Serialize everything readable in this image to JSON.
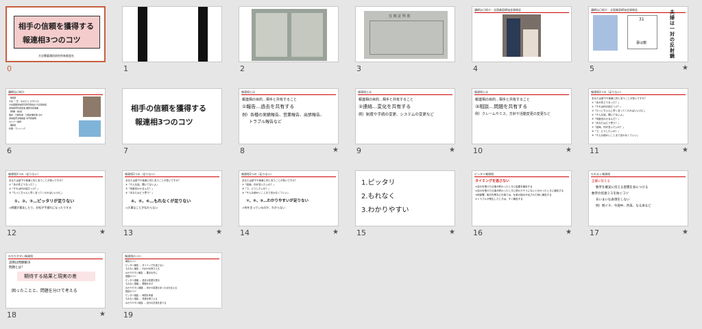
{
  "slides": [
    {
      "num": "0",
      "star": false,
      "title_lines": [
        "相手の信頼を獲得する",
        "報連相3つのコツ"
      ],
      "company": "大谷需要通信研究所有限会社"
    },
    {
      "num": "1",
      "star": false
    },
    {
      "num": "2",
      "star": false
    },
    {
      "num": "3",
      "star": false,
      "doc_title": "在 籍 証 明 書"
    },
    {
      "num": "4",
      "star": false,
      "header": "講師自己紹介：全国美容師協会資格会"
    },
    {
      "num": "5",
      "star": true,
      "header": "講師自己紹介：全国美容師協会資格会",
      "chip_num": "31",
      "chip_text": "妻は鏡",
      "vertical": "夫婦は一対の反射鏡"
    },
    {
      "num": "6",
      "star": false,
      "header": "講師自己紹介",
      "lines": [
        "【経歴】",
        "大谷 一 宏 （おおたに かずひろ）",
        "大谷需要通信研究所有限会社 代表取締役",
        "通信販売利用促進 業務支援事業",
        "【著書・講演】",
        "雑誌・日経新聞・日経産業新聞 ほか",
        "通信販売法規講座 専門家顧問",
        "セミナー講師",
        "【趣味】",
        "料理・ランニング"
      ]
    },
    {
      "num": "7",
      "star": false,
      "title_lines": [
        "相手の信頼を獲得する",
        "報連相3つのコツ"
      ]
    },
    {
      "num": "8",
      "star": true,
      "header": "報連相とは",
      "intro": "報連相の目的…相手と共有すること",
      "line1": "①報告…過去を共有する",
      "line2": "例）各種の実績報告、営業報告、出張報告、",
      "line3": "トラブル報告など"
    },
    {
      "num": "9",
      "star": true,
      "header": "報連相とは",
      "intro": "報連相の目的…相手と共有すること",
      "line1": "②連絡…変化を共有する",
      "line2": "例）制度や手続の変更、システムの変更など"
    },
    {
      "num": "10",
      "star": true,
      "header": "報連相とは",
      "intro": "報連相の目的…相手と共有すること",
      "line1": "③相談…問題を共有する",
      "line2": "例）クレームやミス、方針や活動変更の変更など"
    },
    {
      "num": "11",
      "star": true,
      "header": "報連相3つの（足りない）",
      "lines": [
        "あなたは部下や後輩に何と言うことが多いですか？",
        "①「あの件どうなった？」",
        "②「それは何の話だっけ？」",
        "③「もっとちゃんと早く言ってくれればいいのに」",
        "④「そんな話、聞いてないよ」",
        "⑤「何度言わせるんだ？」",
        "⑥「あなたはどう思う？」",
        "⑦「結局、何が言いたいの？」",
        "⑧「で、どうしたいの？」",
        "⑨「そんな細かいことまで言わなくていい」"
      ]
    },
    {
      "num": "12",
      "star": true,
      "header": "報連相3つの（足りない）",
      "lines": [
        "あなたは部下や後輩に何と言うことが多いですか？",
        "①「あの件どうなった？」",
        "②「それは何の話だっけ？」",
        "③「もっとちゃんと早く言ってくれればいいのに」"
      ],
      "big": "①、②、③…ピッタリが足りない",
      "conclusion": "⇒問題が悪化したり、対処が手遅れになったりする"
    },
    {
      "num": "13",
      "star": true,
      "header": "報連相3つの（足りない）",
      "lines": [
        "あなたは部下や後輩に何と言うことが多いですか？",
        "④「そんな話、聞いてないよ」",
        "⑤「何度言わせるんだ？」",
        "⑥「あなたはどう思う？」"
      ],
      "big": "④、⑤、⑥…もれなくが足りない",
      "conclusion": "⇒大事なことが伝わらない"
    },
    {
      "num": "14",
      "star": true,
      "header": "報連相3つの（足りない）",
      "lines": [
        "あなたは部下や後輩に何と言うことが多いですか？",
        "⑦「結局、何が言いたいの？」",
        "⑧「で、どうしたいの？」",
        "⑨「そんな細かいことまで言わなくていい」"
      ],
      "big": "⑦、⑧、⑨…わかりやすいが足りない",
      "conclusion": "⇒何を言っているのか、わからない"
    },
    {
      "num": "15",
      "star": true,
      "lines": [
        "1.ピッタリ",
        "2.もれなく",
        "3.わかりやすい"
      ]
    },
    {
      "num": "16",
      "star": true,
      "header": "ピッタリ報連相",
      "lead": "タイミングを逃さない",
      "lines": [
        "①自分を受けた仕事が終わったときに結果を報告する",
        "②自分を受けた仕事が終わったときに終わりそうにないと分かったときに報告する",
        "③他部署、取引先等など仕事では、仕事の指示が出された時に報告する",
        "④トラブルが発生したときは、すぐ報告する"
      ]
    },
    {
      "num": "17",
      "star": true,
      "header": "もれなく報連相",
      "lines": [
        "正確に伝える",
        "数字を確実に伝える習慣を身につける",
        "数字の伝達ミスを防ぐコツ",
        "あいまいな表現をしない",
        "例）明イチ、今週中、月末、なる早など"
      ]
    },
    {
      "num": "18",
      "star": true,
      "header": "わかりやすい報連相",
      "lines": [
        "説明は問題解決",
        "問題とは？"
      ],
      "box": "期待する結果と現実の差",
      "bottom": "困ったことと、問題を分けて考える"
    },
    {
      "num": "19",
      "star": false,
      "header": "報連相のコツ",
      "lines": [
        "報告のコツ",
        "ピッタリ報告 … タイミングを逃さない",
        "もれなく報告 … 5W1Hを押さえる",
        "わかりやすい報告 … 要点を先に",
        "連絡のコツ",
        "ピッタリ連絡 … 過去の変更を表示",
        "もれなく連絡 … 根拠を示す",
        "わかりやすい連絡 … 何かの変更のあった点を伝える",
        "相談のコツ",
        "ピッタリ相談 … 時間を考慮",
        "もれなく相談 … 事実を押さえる",
        "わかりやすい相談 … 自分の意見を述べる"
      ]
    }
  ]
}
